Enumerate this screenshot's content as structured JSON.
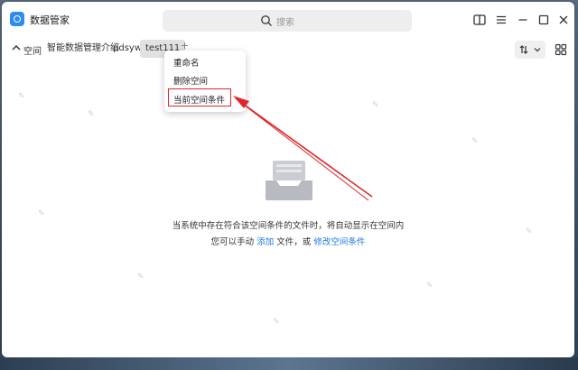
{
  "app": {
    "title": "数据管家"
  },
  "search": {
    "placeholder": "搜索"
  },
  "tabs": {
    "space_label": "空间",
    "items": [
      {
        "label": "智能数据管理介绍",
        "active": false
      },
      {
        "label": "pdsyw",
        "active": false
      },
      {
        "label": "test111",
        "active": true
      }
    ],
    "add_label": "+"
  },
  "context_menu": {
    "items": [
      {
        "label": "重命名"
      },
      {
        "label": "删除空间"
      },
      {
        "label": "当前空间条件",
        "highlighted": true
      }
    ]
  },
  "empty_state": {
    "line1": "当系统中存在符合该空间条件的文件时，将自动显示在空间内",
    "line2_prefix": "您可以手动",
    "add_link": "添加",
    "line2_mid": "文件，或",
    "modify_link": "修改空间条件"
  },
  "colors": {
    "accent": "#2d8cf0",
    "link": "#1f7ae0",
    "highlight_box": "#e0262a"
  }
}
